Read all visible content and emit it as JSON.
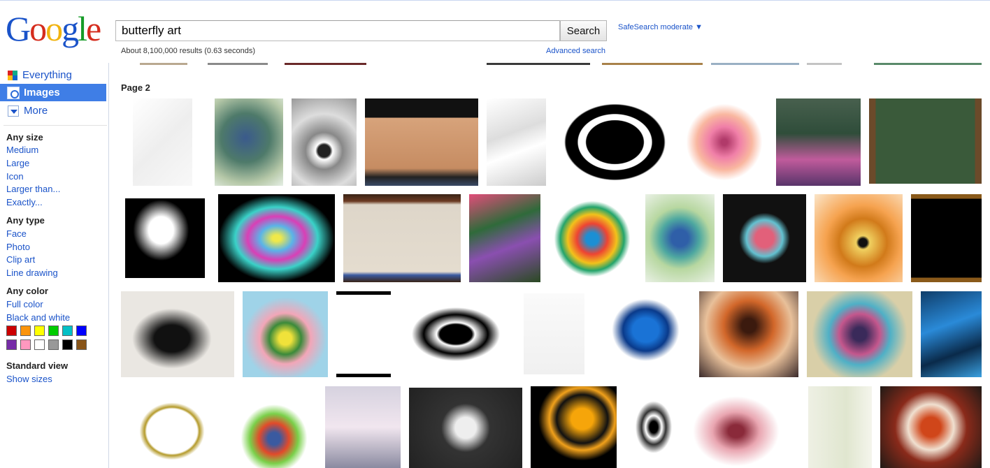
{
  "logo": {
    "letters": [
      "G",
      "o",
      "o",
      "g",
      "l",
      "e"
    ]
  },
  "search": {
    "query": "butterfly art",
    "button_label": "Search",
    "safesearch": "SafeSearch moderate ▼",
    "results_stat": "About 8,100,000 results (0.63 seconds)",
    "advanced": "Advanced search"
  },
  "nav": {
    "items": [
      {
        "label": "Everything",
        "icon": "everything-icon"
      },
      {
        "label": "Images",
        "icon": "images-icon"
      },
      {
        "label": "More",
        "icon": "more-icon"
      }
    ]
  },
  "facets": {
    "size": {
      "head": "Any size",
      "options": [
        "Medium",
        "Large",
        "Icon",
        "Larger than...",
        "Exactly..."
      ]
    },
    "type": {
      "head": "Any type",
      "options": [
        "Face",
        "Photo",
        "Clip art",
        "Line drawing"
      ]
    },
    "color": {
      "head": "Any color",
      "options": [
        "Full color",
        "Black and white"
      ],
      "swatches": [
        "#cc0000",
        "#fb940b",
        "#ffff00",
        "#00cc00",
        "#03c0c6",
        "#0000ff",
        "#762ca7",
        "#ff98bf",
        "#ffffff",
        "#999999",
        "#000000",
        "#885418"
      ]
    },
    "view": {
      "head": "Standard view",
      "options": [
        "Show sizes"
      ]
    }
  },
  "results": {
    "page_label": "Page 2"
  },
  "colors": {
    "link": "#1a53c9",
    "active_nav": "#3f7ee6"
  }
}
